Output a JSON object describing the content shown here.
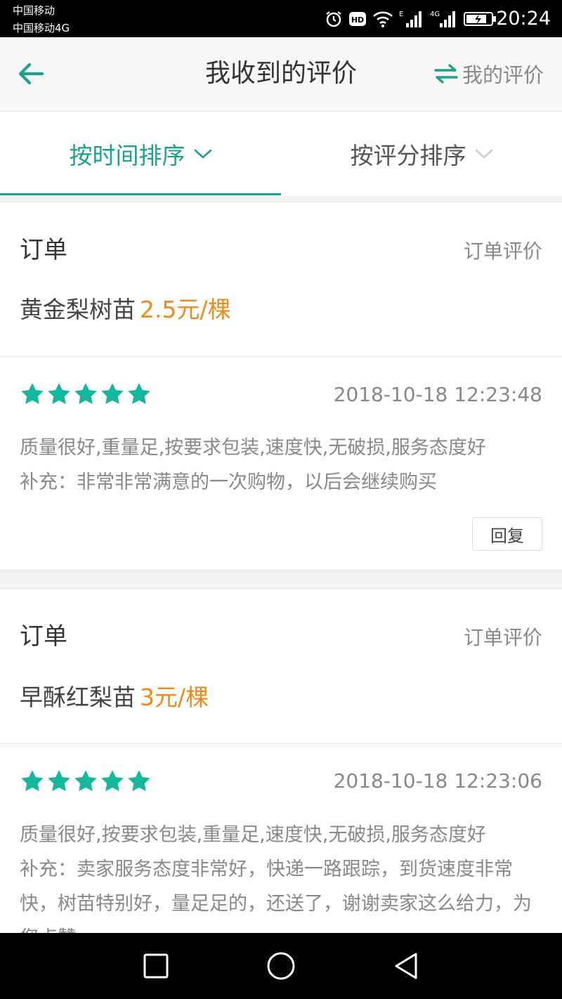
{
  "status_bar": {
    "carrier1": "中国移动",
    "carrier2": "中国移动4G",
    "icons": [
      "alarm-icon",
      "hd-icon",
      "wifi-icon",
      "signal-e-icon",
      "signal-4g-icon",
      "battery-icon"
    ],
    "time": "20:24"
  },
  "header": {
    "back_icon": "arrow-left-icon",
    "title": "我收到的评价",
    "switch_icon": "swap-arrows-icon",
    "switch_label": "我的评价"
  },
  "tabs": [
    {
      "label": "按时间排序",
      "active": true
    },
    {
      "label": "按评分排序",
      "active": false
    }
  ],
  "orders": [
    {
      "title": "订单",
      "link": "订单评价",
      "product": "黄金梨树苗",
      "price": "2.5元/棵",
      "rating": 5,
      "date": "2018-10-18 12:23:48",
      "tags": "质量很好,重量足,按要求包装,速度快,无破损,服务态度好",
      "comment": "补充：非常非常满意的一次购物，以后会继续购买",
      "reply_label": "回复"
    },
    {
      "title": "订单",
      "link": "订单评价",
      "product": "早酥红梨苗",
      "price": "3元/棵",
      "rating": 5,
      "date": "2018-10-18 12:23:06",
      "tags": "质量很好,按要求包装,重量足,速度快,无破损,服务态度好",
      "comment": "补充：卖家服务态度非常好，快递一路跟踪，到货速度非常快，树苗特别好，量足足的，还送了，谢谢卖家这么给力，为您点赞"
    }
  ],
  "colors": {
    "accent": "#1aa38c",
    "price": "#ef8a17",
    "star": "#14b89c"
  },
  "nav": [
    "square-icon",
    "circle-icon",
    "triangle-back-icon"
  ]
}
